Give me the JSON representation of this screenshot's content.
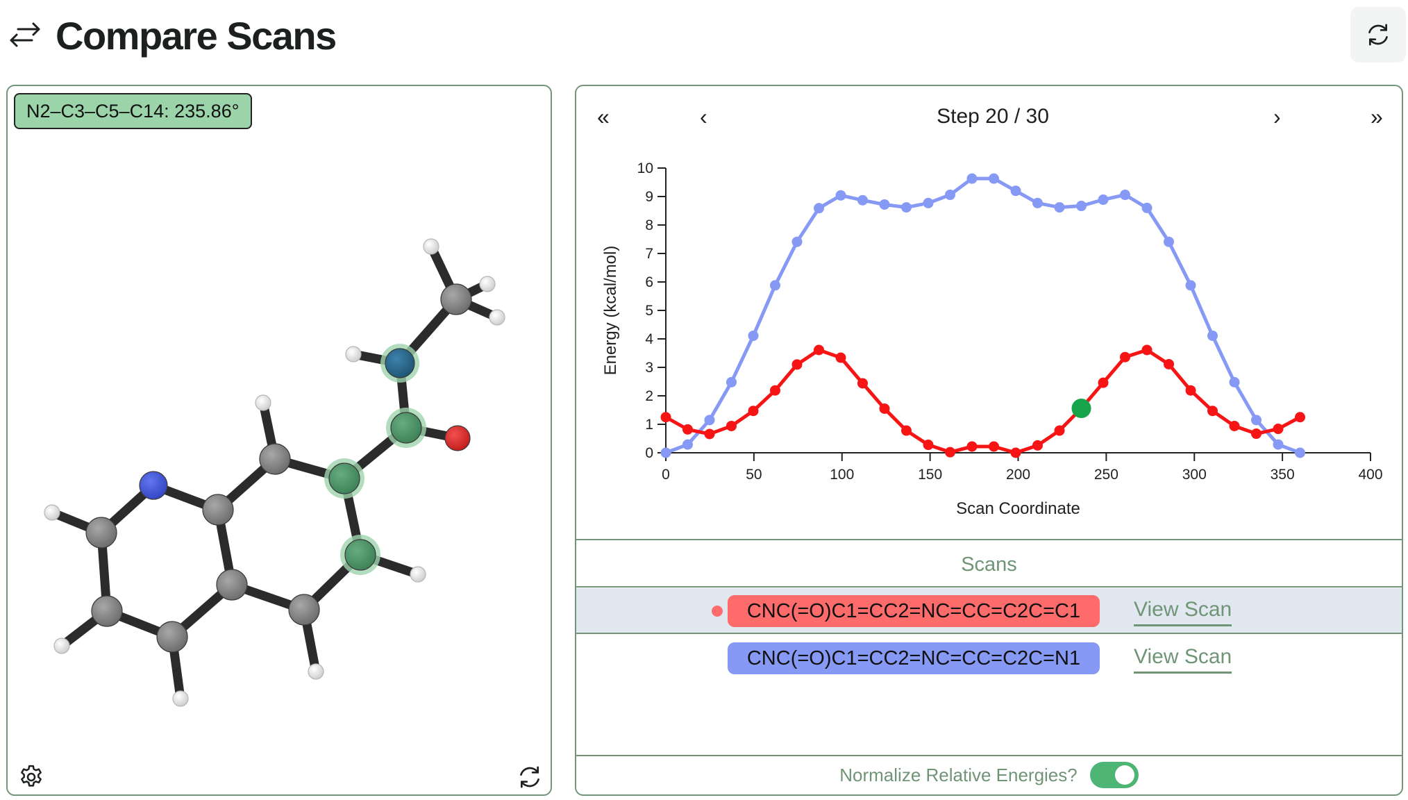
{
  "header": {
    "title": "Compare Scans",
    "title_icon": "swap-arrows-icon",
    "refresh_button_icon": "refresh-icon"
  },
  "viewer": {
    "dihedral_label": "N2–C3–C5–C14: 235.86°",
    "settings_icon": "gear-icon",
    "reset_view_icon": "refresh-icon",
    "colors": {
      "carbon": "#858585",
      "hydrogen": "#f0f0f0",
      "nitrogen_ring": "#4a5fd9",
      "nitrogen_amide": "#2a6b93",
      "oxygen": "#e03030",
      "highlight": "#4f9a6c",
      "bond": "#2b2b2b"
    },
    "atoms": [
      {
        "id": "H1",
        "el": "H"
      },
      {
        "id": "C_methyl",
        "el": "C"
      },
      {
        "id": "H2",
        "el": "H"
      },
      {
        "id": "H3",
        "el": "H"
      },
      {
        "id": "N2",
        "el": "N_amide",
        "highlight": true
      },
      {
        "id": "H4",
        "el": "H"
      },
      {
        "id": "C3",
        "el": "C",
        "highlight": true
      },
      {
        "id": "O",
        "el": "O"
      },
      {
        "id": "C5",
        "el": "C",
        "highlight": true
      },
      {
        "id": "C_top",
        "el": "C"
      },
      {
        "id": "H5",
        "el": "H"
      },
      {
        "id": "C_j1",
        "el": "C"
      },
      {
        "id": "N_ring",
        "el": "N_ring"
      },
      {
        "id": "C_left",
        "el": "C"
      },
      {
        "id": "H6",
        "el": "H"
      },
      {
        "id": "C_bl",
        "el": "C"
      },
      {
        "id": "H7",
        "el": "H"
      },
      {
        "id": "C_bot",
        "el": "C"
      },
      {
        "id": "H8",
        "el": "H"
      },
      {
        "id": "C_j2",
        "el": "C"
      },
      {
        "id": "C_br",
        "el": "C"
      },
      {
        "id": "H9",
        "el": "H"
      },
      {
        "id": "C14",
        "el": "C",
        "highlight": true
      },
      {
        "id": "H10",
        "el": "H"
      }
    ]
  },
  "navigation": {
    "first_label": "«",
    "prev_label": "‹",
    "next_label": "›",
    "last_label": "»",
    "step_label": "Step 20 / 30",
    "current_step": 20,
    "total_steps": 30
  },
  "chart_data": {
    "type": "line",
    "title": "",
    "xlabel": "Scan Coordinate",
    "ylabel": "Energy (kcal/mol)",
    "xlim": [
      0,
      400
    ],
    "ylim": [
      0,
      10
    ],
    "xticks": [
      0,
      50,
      100,
      150,
      200,
      250,
      300,
      350,
      400
    ],
    "yticks": [
      0,
      1,
      2,
      3,
      4,
      5,
      6,
      7,
      8,
      9,
      10
    ],
    "grid": false,
    "x": [
      0,
      12.41,
      24.83,
      37.24,
      49.66,
      62.07,
      74.48,
      86.9,
      99.31,
      111.72,
      124.14,
      136.55,
      148.97,
      161.38,
      173.79,
      186.21,
      198.62,
      211.03,
      223.45,
      235.86,
      248.28,
      260.69,
      273.1,
      285.52,
      297.93,
      310.34,
      322.76,
      335.17,
      347.59,
      360
    ],
    "series": [
      {
        "name": "CNC(=O)C1=CC2=NC=CC=C2C=N1",
        "color": "#8599f5",
        "values": [
          0,
          0.29,
          1.15,
          2.48,
          4.11,
          5.88,
          7.41,
          8.59,
          9.04,
          8.87,
          8.72,
          8.62,
          8.77,
          9.06,
          9.63,
          9.63,
          9.2,
          8.77,
          8.62,
          8.67,
          8.89,
          9.06,
          8.6,
          7.41,
          5.88,
          4.11,
          2.48,
          1.15,
          0.29,
          0
        ]
      },
      {
        "name": "CNC(=O)C1=CC2=NC=CC=C2C=C1",
        "color": "#f71414",
        "values": [
          1.25,
          0.82,
          0.66,
          0.94,
          1.47,
          2.19,
          3.1,
          3.61,
          3.34,
          2.44,
          1.55,
          0.78,
          0.28,
          0.02,
          0.22,
          0.22,
          0.0,
          0.26,
          0.78,
          1.56,
          2.46,
          3.36,
          3.61,
          3.11,
          2.19,
          1.47,
          0.94,
          0.67,
          0.84,
          1.25
        ]
      }
    ],
    "highlight": {
      "series": 1,
      "index": 19,
      "x": 235.86,
      "y": 1.56,
      "color": "#16a34a"
    }
  },
  "scans": {
    "header": "Scans",
    "rows": [
      {
        "smiles": "CNC(=O)C1=CC2=NC=CC=C2C=C1",
        "color": "#fd6b6b",
        "active": true,
        "dot_color": "#fd6b6b",
        "link": "View Scan"
      },
      {
        "smiles": "CNC(=O)C1=CC2=NC=CC=C2C=N1",
        "color": "#8599f5",
        "active": false,
        "link": "View Scan"
      }
    ]
  },
  "options": {
    "normalize_label": "Normalize Relative Energies?",
    "normalize_on": true,
    "toggle_color": "#4fb574"
  }
}
